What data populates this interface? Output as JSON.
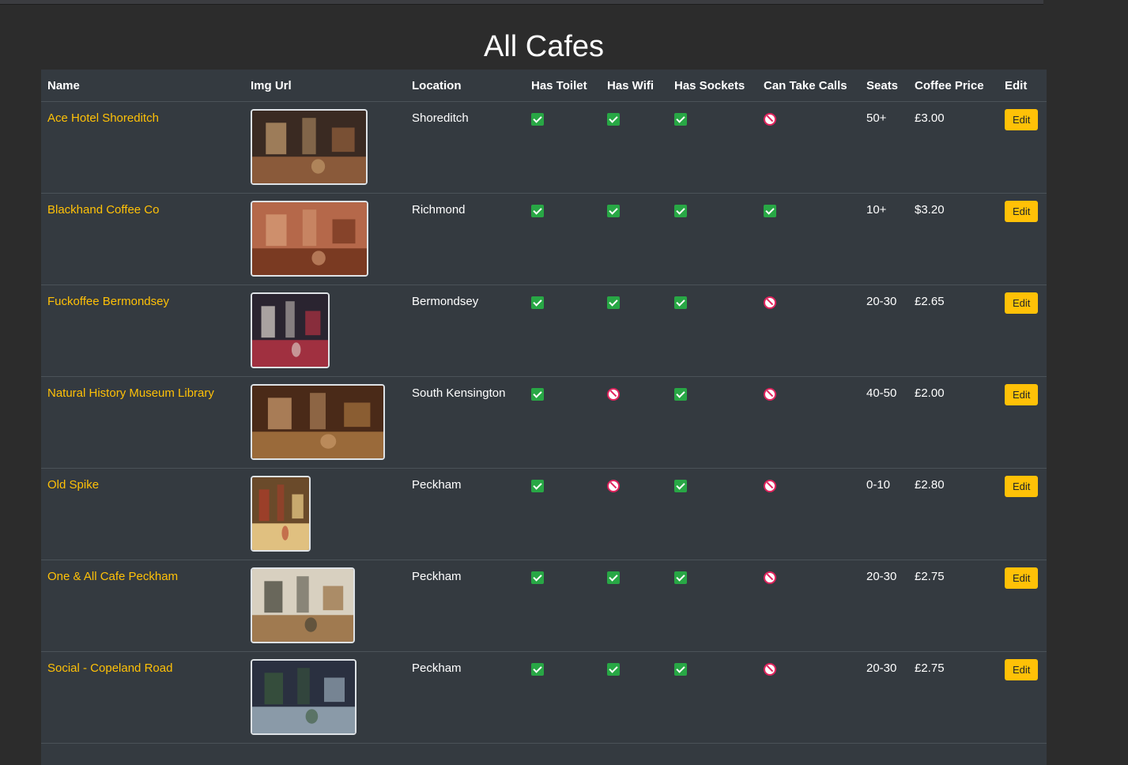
{
  "page": {
    "title": "All Cafes"
  },
  "table": {
    "headers": [
      "Name",
      "Img Url",
      "Location",
      "Has Toilet",
      "Has Wifi",
      "Has Sockets",
      "Can Take Calls",
      "Seats",
      "Coffee Price",
      "Edit"
    ],
    "rows": [
      {
        "name": "Ace Hotel Shoreditch",
        "location": "Shoreditch",
        "has_toilet": true,
        "has_wifi": true,
        "has_sockets": true,
        "can_take_calls": false,
        "seats": "50+",
        "price": "£3.00",
        "edit": "Edit",
        "thumb_width": 148,
        "thumb_colors": [
          "#3a2a22",
          "#8a5a3a",
          "#c8a070"
        ]
      },
      {
        "name": "Blackhand Coffee Co",
        "location": "Richmond",
        "has_toilet": true,
        "has_wifi": true,
        "has_sockets": true,
        "can_take_calls": true,
        "seats": "10+",
        "price": "$3.20",
        "edit": "Edit",
        "thumb_width": 149,
        "thumb_colors": [
          "#b5684a",
          "#7a3a22",
          "#d9a07a"
        ]
      },
      {
        "name": "Fuckoffee Bermondsey",
        "location": "Bermondsey",
        "has_toilet": true,
        "has_wifi": true,
        "has_sockets": true,
        "can_take_calls": false,
        "seats": "20-30",
        "price": "£2.65",
        "edit": "Edit",
        "thumb_width": 100,
        "thumb_colors": [
          "#2a2430",
          "#a03040",
          "#e0d8d0"
        ]
      },
      {
        "name": "Natural History Museum Library",
        "location": "South Kensington",
        "has_toilet": true,
        "has_wifi": false,
        "has_sockets": true,
        "can_take_calls": false,
        "seats": "40-50",
        "price": "£2.00",
        "edit": "Edit",
        "thumb_width": 170,
        "thumb_colors": [
          "#4a2a18",
          "#9a6a3a",
          "#d0a070"
        ]
      },
      {
        "name": "Old Spike",
        "location": "Peckham",
        "has_toilet": true,
        "has_wifi": false,
        "has_sockets": true,
        "can_take_calls": false,
        "seats": "0-10",
        "price": "£2.80",
        "edit": "Edit",
        "thumb_width": 76,
        "thumb_colors": [
          "#6a4a2a",
          "#e0c080",
          "#b03a2a"
        ]
      },
      {
        "name": "One & All Cafe Peckham",
        "location": "Peckham",
        "has_toilet": true,
        "has_wifi": true,
        "has_sockets": true,
        "can_take_calls": false,
        "seats": "20-30",
        "price": "£2.75",
        "edit": "Edit",
        "thumb_width": 132,
        "thumb_colors": [
          "#d8d0c0",
          "#a07a50",
          "#3a3a30"
        ]
      },
      {
        "name": "Social - Copeland Road",
        "location": "Peckham",
        "has_toilet": true,
        "has_wifi": true,
        "has_sockets": true,
        "can_take_calls": false,
        "seats": "20-30",
        "price": "£2.75",
        "edit": "Edit",
        "thumb_width": 134,
        "thumb_colors": [
          "#2a3040",
          "#8a9aa8",
          "#3a5a3a"
        ]
      }
    ]
  },
  "icons": {
    "check": "check-icon",
    "no": "no-entry-icon"
  },
  "colors": {
    "accent": "#ffc107",
    "check": "#28a745",
    "no": "#e0245e",
    "table_bg": "#343a40"
  }
}
